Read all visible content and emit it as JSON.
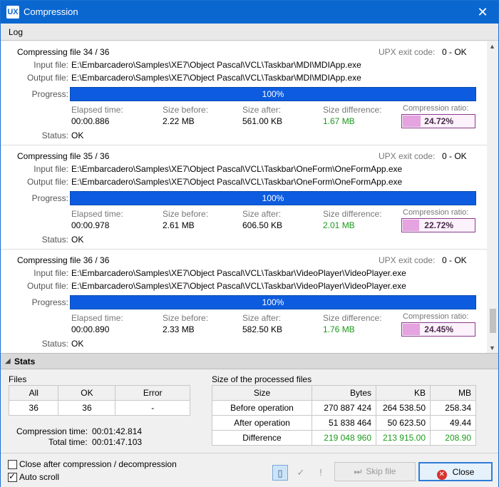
{
  "window": {
    "title": "Compression",
    "app_icon": "UX"
  },
  "log_header": "Log",
  "labels": {
    "input_file": "Input file:",
    "output_file": "Output file:",
    "progress": "Progress:",
    "status": "Status:",
    "elapsed_time": "Elapsed time:",
    "size_before": "Size before:",
    "size_after": "Size after:",
    "size_difference": "Size difference:",
    "compression_ratio": "Compression ratio:",
    "upx_exit_code": "UPX exit code:"
  },
  "entries": [
    {
      "heading": "Compressing file 34 / 36",
      "upx_exit": "0 - OK",
      "input": "E:\\Embarcadero\\Samples\\XE7\\Object Pascal\\VCL\\Taskbar\\MDI\\MDIApp.exe",
      "output": "E:\\Embarcadero\\Samples\\XE7\\Object Pascal\\VCL\\Taskbar\\MDI\\MDIApp.exe",
      "progress_text": "100%",
      "progress_value": 1.0,
      "elapsed": "00:00.886",
      "size_before": "2.22 MB",
      "size_after": "561.00 KB",
      "size_diff": "1.67 MB",
      "ratio": "24.72%",
      "ratio_value": 0.2472,
      "status": "OK"
    },
    {
      "heading": "Compressing file 35 / 36",
      "upx_exit": "0 - OK",
      "input": "E:\\Embarcadero\\Samples\\XE7\\Object Pascal\\VCL\\Taskbar\\OneForm\\OneFormApp.exe",
      "output": "E:\\Embarcadero\\Samples\\XE7\\Object Pascal\\VCL\\Taskbar\\OneForm\\OneFormApp.exe",
      "progress_text": "100%",
      "progress_value": 1.0,
      "elapsed": "00:00.978",
      "size_before": "2.61 MB",
      "size_after": "606.50 KB",
      "size_diff": "2.01 MB",
      "ratio": "22.72%",
      "ratio_value": 0.2272,
      "status": "OK"
    },
    {
      "heading": "Compressing file 36 / 36",
      "upx_exit": "0 - OK",
      "input": "E:\\Embarcadero\\Samples\\XE7\\Object Pascal\\VCL\\Taskbar\\VideoPlayer\\VideoPlayer.exe",
      "output": "E:\\Embarcadero\\Samples\\XE7\\Object Pascal\\VCL\\Taskbar\\VideoPlayer\\VideoPlayer.exe",
      "progress_text": "100%",
      "progress_value": 1.0,
      "elapsed": "00:00.890",
      "size_before": "2.33 MB",
      "size_after": "582.50 KB",
      "size_diff": "1.76 MB",
      "ratio": "24.45%",
      "ratio_value": 0.2445,
      "status": "OK"
    }
  ],
  "stats": {
    "header": "Stats",
    "files_label": "Files",
    "files_table": {
      "headers": [
        "All",
        "OK",
        "Error"
      ],
      "row": [
        "36",
        "36",
        "-"
      ]
    },
    "compression_time_label": "Compression time:",
    "compression_time": "00:01:42.814",
    "total_time_label": "Total time:",
    "total_time": "00:01:47.103",
    "size_label": "Size of the processed files",
    "size_table": {
      "headers": [
        "Size",
        "Bytes",
        "KB",
        "MB"
      ],
      "rows": [
        [
          "Before operation",
          "270 887 424",
          "264 538.50",
          "258.34"
        ],
        [
          "After operation",
          "51 838 464",
          "50 623.50",
          "49.44"
        ],
        [
          "Difference",
          "219 048 960",
          "213 915.00",
          "208.90"
        ]
      ]
    }
  },
  "options": {
    "close_after": {
      "label": "Close after compression / decompression",
      "checked": false
    },
    "auto_scroll": {
      "label": "Auto scroll",
      "checked": true
    }
  },
  "buttons": {
    "skip_file": "Skip file",
    "close": "Close"
  },
  "colors": {
    "titlebar": "#0b67d0",
    "progress": "#0d5ce0",
    "ratio_fill": "#e5a3e0",
    "difference_green": "#1a9a1a"
  }
}
